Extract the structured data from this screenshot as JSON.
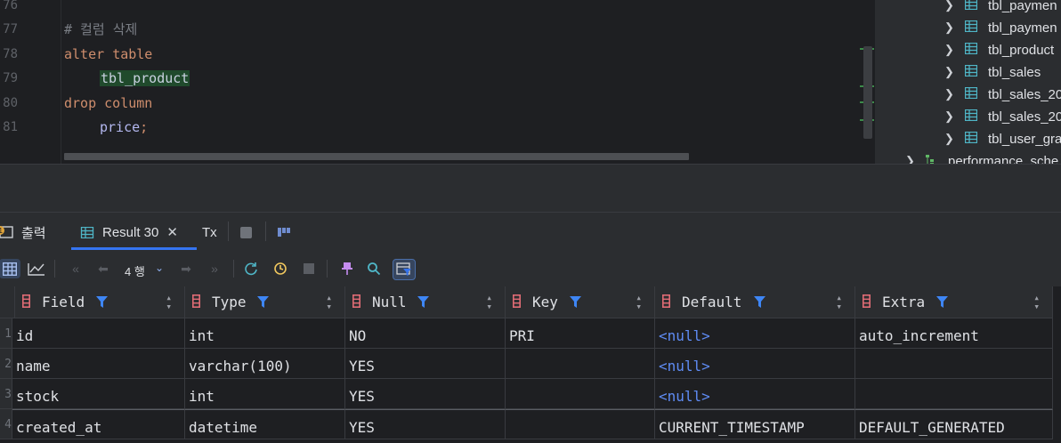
{
  "editor": {
    "lines": [
      {
        "num": "76",
        "code": ""
      },
      {
        "num": "77",
        "code": "# 컬럼 삭제"
      },
      {
        "num": "78",
        "code": "alter table"
      },
      {
        "num": "79",
        "code": "tbl_product"
      },
      {
        "num": "80",
        "code": "drop column"
      },
      {
        "num": "81",
        "code": "price;"
      }
    ],
    "comment": "# 컬럼 삭제",
    "kw_alter": "alter",
    "kw_table": "table",
    "table_name": "tbl_product",
    "kw_drop": "drop",
    "kw_column": "column",
    "field": "price",
    "semicolon": ";"
  },
  "tree": {
    "items": [
      {
        "label": "tbl_paymen",
        "icon": "table-icon"
      },
      {
        "label": "tbl_paymen",
        "icon": "table-icon"
      },
      {
        "label": "tbl_product",
        "icon": "table-icon"
      },
      {
        "label": "tbl_sales",
        "icon": "table-icon"
      },
      {
        "label": "tbl_sales_20",
        "icon": "table-icon"
      },
      {
        "label": "tbl_sales_20",
        "icon": "table-icon"
      },
      {
        "label": "tbl_user_gra",
        "icon": "table-icon"
      }
    ],
    "schema_label": "performance_sche"
  },
  "tabs": {
    "output_label": "출력",
    "result_label": "Result 30",
    "tx_label": "Tx"
  },
  "toolbar": {
    "rows_label": "4 행"
  },
  "grid": {
    "columns": [
      "Field",
      "Type",
      "Null",
      "Key",
      "Default",
      "Extra"
    ],
    "rows": [
      {
        "num": "1",
        "cells": [
          "id",
          "int",
          "NO",
          "PRI",
          "<null>",
          "auto_increment"
        ]
      },
      {
        "num": "2",
        "cells": [
          "name",
          "varchar(100)",
          "YES",
          "",
          "<null>",
          ""
        ]
      },
      {
        "num": "3",
        "cells": [
          "stock",
          "int",
          "YES",
          "",
          "<null>",
          ""
        ]
      },
      {
        "num": "4",
        "cells": [
          "created_at",
          "datetime",
          "YES",
          "",
          "CURRENT_TIMESTAMP",
          "DEFAULT_GENERATED"
        ]
      }
    ]
  },
  "colors": {
    "accent": "#3574f0",
    "keyword": "#cf8e6d",
    "null_value": "#5f8cf5",
    "highlight": "#204a2c"
  }
}
